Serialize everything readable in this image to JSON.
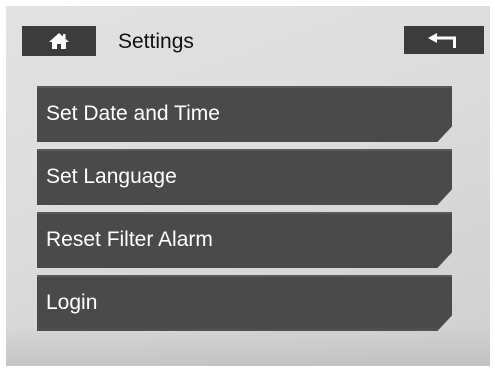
{
  "header": {
    "title": "Settings",
    "home_icon": "home-icon",
    "back_icon": "back-arrow-icon"
  },
  "menu": {
    "items": [
      {
        "label": "Set Date and Time"
      },
      {
        "label": "Set Language"
      },
      {
        "label": "Reset Filter Alarm"
      },
      {
        "label": "Login"
      }
    ]
  },
  "colors": {
    "background": "#dcdcdc",
    "button": "#3c3c3c",
    "menu_item": "#4a4a4a",
    "menu_text": "#ffffff",
    "title_text": "#111111"
  }
}
